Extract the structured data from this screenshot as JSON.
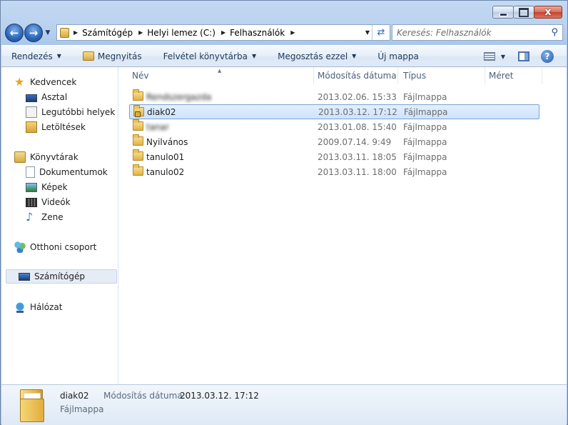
{
  "address": {
    "segments": [
      "Számítógép",
      "Helyi lemez (C:)",
      "Felhasználók"
    ]
  },
  "search": {
    "placeholder": "Keresés: Felhasználók"
  },
  "toolbar": {
    "organize": "Rendezés",
    "open": "Megnyitás",
    "include_library": "Felvétel könyvtárba",
    "share": "Megosztás ezzel",
    "new_folder": "Új mappa"
  },
  "sidebar": {
    "favorites": "Kedvencek",
    "desktop": "Asztal",
    "recent": "Legutóbbi helyek",
    "downloads": "Letöltések",
    "libraries": "Könyvtárak",
    "documents": "Dokumentumok",
    "pictures": "Képek",
    "videos": "Videók",
    "music": "Zene",
    "homegroup": "Otthoni csoport",
    "computer": "Számítógép",
    "network": "Hálózat"
  },
  "columns": {
    "name": "Név",
    "modified": "Módosítás dátuma",
    "type": "Típus",
    "size": "Méret"
  },
  "files": [
    {
      "name": "Rendszergazda",
      "date": "2013.02.06. 15:33",
      "type": "Fájlmappa",
      "blurred": true
    },
    {
      "name": "diak02",
      "date": "2013.03.12. 17:12",
      "type": "Fájlmappa",
      "selected": true,
      "locked": true
    },
    {
      "name": "tanar",
      "date": "2013.01.08. 15:40",
      "type": "Fájlmappa",
      "blurred": true
    },
    {
      "name": "Nyilvános",
      "date": "2009.07.14. 9:49",
      "type": "Fájlmappa"
    },
    {
      "name": "tanulo01",
      "date": "2013.03.11. 18:05",
      "type": "Fájlmappa"
    },
    {
      "name": "tanulo02",
      "date": "2013.03.11. 18:00",
      "type": "Fájlmappa"
    }
  ],
  "details": {
    "name": "diak02",
    "modified_label": "Módosítás dátuma:",
    "modified_value": "2013.03.12. 17:12",
    "type": "Fájlmappa"
  },
  "window": {
    "close_glyph": "x"
  }
}
